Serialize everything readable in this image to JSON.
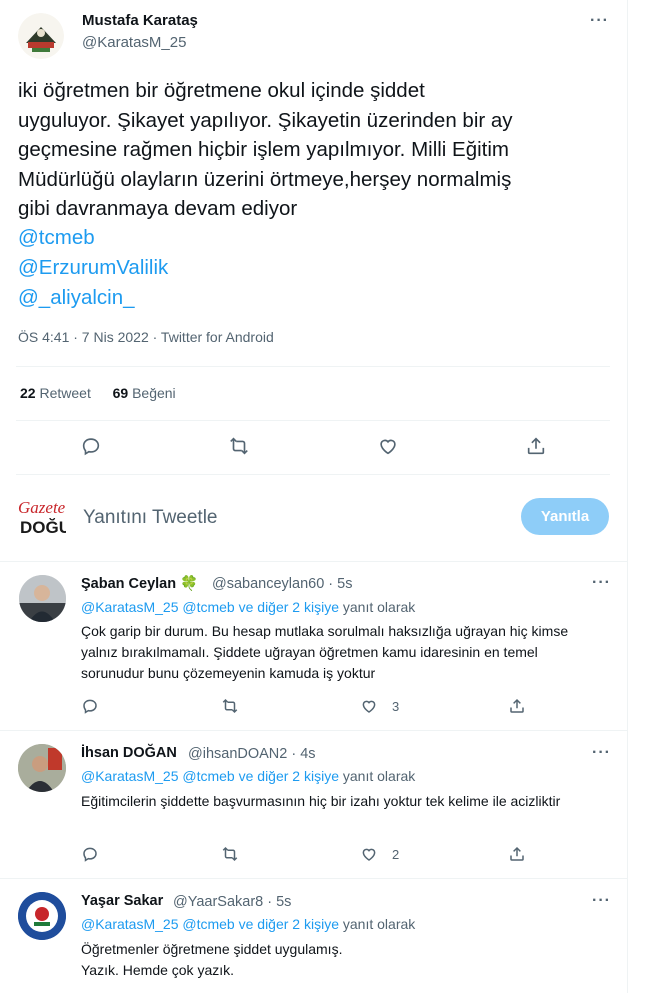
{
  "tweet": {
    "author_name": "Mustafa Karataş",
    "author_handle": "@KaratasM_25",
    "text": "iki öğretmen bir öğretmene okul içinde şiddet\nuyguluyor. Şikayet yapılıyor. Şikayetin üzerinden bir ay\ngeçmesine rağmen hiçbir işlem yapılmıyor. Milli Eğitim\nMüdürlüğü olayların üzerini örtmeye,herşey normalmiş\ngibi davranmaya devam ediyor",
    "mentions": [
      "@tcmeb",
      "@ErzurumValilik",
      "@_aliyalcin_"
    ],
    "meta": "ÖS 4:41 · 7 Nis 2022 · Twitter for Android",
    "retweet_count": "22",
    "retweet_label": "Retweet",
    "like_count": "69",
    "like_label": "Beğeni",
    "more_label": "···"
  },
  "composer": {
    "placeholder": "Yanıtını Tweetle",
    "button_label": "Yanıtla"
  },
  "replies": [
    {
      "name": "Şaban Ceylan",
      "badge": "🍀",
      "handle_time": "@sabanceylan60 · 5s",
      "reply_to_users": "@KaratasM_25 @tcmeb",
      "reply_to_others": " ve diğer 2 kişiye",
      "reply_to_suffix": " yanıt olarak",
      "text": "Çok garip bir durum. Bu hesap mutlaka sorulmalı haksızlığa uğrayan hiç kimse yalnız bırakılmamalı. Şiddete uğrayan öğretmen kamu idaresinin en temel sorunudur bunu çözemeyenin kamuda iş yoktur",
      "like_count": "3"
    },
    {
      "name": "İhsan DOĞAN",
      "badge": "",
      "handle_time": "@ihsanDOAN2 · 4s",
      "reply_to_users": "@KaratasM_25 @tcmeb",
      "reply_to_others": " ve diğer 2 kişiye",
      "reply_to_suffix": " yanıt olarak",
      "text": "Eğitimcilerin şiddette başvurmasının hiç bir izahı yoktur tek kelime ile acizliktir",
      "like_count": "2"
    },
    {
      "name": "Yaşar Sakar",
      "badge": "",
      "handle_time": "@YaarSakar8 · 5s",
      "reply_to_users": "@KaratasM_25 @tcmeb",
      "reply_to_others": " ve diğer 2 kişiye",
      "reply_to_suffix": " yanıt olarak",
      "text": "Öğretmenler öğretmene şiddet uygulamış.\nYazık. Hemde çok yazık.",
      "like_count": ""
    }
  ],
  "icons": {
    "reply": "reply-icon",
    "retweet": "retweet-icon",
    "like": "heart-icon",
    "share": "share-icon",
    "more": "more-icon"
  },
  "colors": {
    "accent": "#1d9bf0",
    "button_disabled": "#8ecdf8",
    "secondary_text": "#536471",
    "divider": "#eff3f4"
  }
}
